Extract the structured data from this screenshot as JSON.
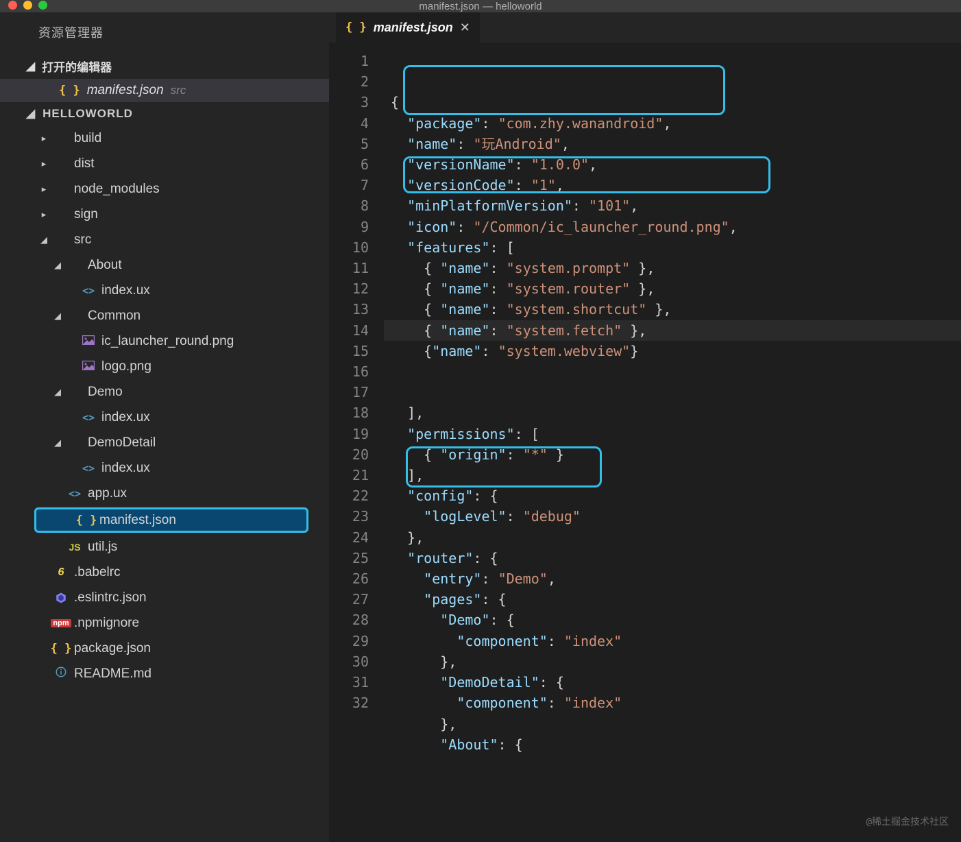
{
  "window": {
    "title": "manifest.json — helloworld"
  },
  "sidebar": {
    "title": "资源管理器",
    "openEditorsLabel": "打开的编辑器",
    "openEditor": {
      "filename": "manifest.json",
      "path": "src"
    },
    "projectName": "HELLOWORLD",
    "tree": [
      {
        "depth": 0,
        "kind": "folder",
        "expanded": false,
        "label": "build"
      },
      {
        "depth": 0,
        "kind": "folder",
        "expanded": false,
        "label": "dist"
      },
      {
        "depth": 0,
        "kind": "folder",
        "expanded": false,
        "label": "node_modules"
      },
      {
        "depth": 0,
        "kind": "folder",
        "expanded": false,
        "label": "sign"
      },
      {
        "depth": 0,
        "kind": "folder",
        "expanded": true,
        "label": "src"
      },
      {
        "depth": 1,
        "kind": "folder",
        "expanded": true,
        "label": "About"
      },
      {
        "depth": 2,
        "kind": "file",
        "icon": "code",
        "label": "index.ux"
      },
      {
        "depth": 1,
        "kind": "folder",
        "expanded": true,
        "label": "Common"
      },
      {
        "depth": 2,
        "kind": "file",
        "icon": "image",
        "label": "ic_launcher_round.png"
      },
      {
        "depth": 2,
        "kind": "file",
        "icon": "image",
        "label": "logo.png"
      },
      {
        "depth": 1,
        "kind": "folder",
        "expanded": true,
        "label": "Demo"
      },
      {
        "depth": 2,
        "kind": "file",
        "icon": "code",
        "label": "index.ux"
      },
      {
        "depth": 1,
        "kind": "folder",
        "expanded": true,
        "label": "DemoDetail"
      },
      {
        "depth": 2,
        "kind": "file",
        "icon": "code",
        "label": "index.ux"
      },
      {
        "depth": 1,
        "kind": "file",
        "icon": "code",
        "label": "app.ux"
      },
      {
        "depth": 1,
        "kind": "file",
        "icon": "braces",
        "label": "manifest.json",
        "selected": true
      },
      {
        "depth": 1,
        "kind": "file",
        "icon": "js",
        "label": "util.js"
      },
      {
        "depth": 0,
        "kind": "file",
        "icon": "babel",
        "label": ".babelrc"
      },
      {
        "depth": 0,
        "kind": "file",
        "icon": "eslint",
        "label": ".eslintrc.json"
      },
      {
        "depth": 0,
        "kind": "file",
        "icon": "npm",
        "label": ".npmignore"
      },
      {
        "depth": 0,
        "kind": "file",
        "icon": "braces",
        "label": "package.json"
      },
      {
        "depth": 0,
        "kind": "file",
        "icon": "info",
        "label": "README.md"
      }
    ]
  },
  "tab": {
    "label": "manifest.json"
  },
  "code": {
    "lines": [
      [
        {
          "t": "brace",
          "v": "{"
        }
      ],
      [
        {
          "t": "sp",
          "v": "  "
        },
        {
          "t": "key",
          "v": "\"package\""
        },
        {
          "t": "punct",
          "v": ": "
        },
        {
          "t": "str",
          "v": "\"com.zhy.wanandroid\""
        },
        {
          "t": "punct",
          "v": ","
        }
      ],
      [
        {
          "t": "sp",
          "v": "  "
        },
        {
          "t": "key",
          "v": "\"name\""
        },
        {
          "t": "punct",
          "v": ": "
        },
        {
          "t": "str",
          "v": "\"玩Android\""
        },
        {
          "t": "punct",
          "v": ","
        }
      ],
      [
        {
          "t": "sp",
          "v": "  "
        },
        {
          "t": "key",
          "v": "\"versionName\""
        },
        {
          "t": "punct",
          "v": ": "
        },
        {
          "t": "str",
          "v": "\"1.0.0\""
        },
        {
          "t": "punct",
          "v": ","
        }
      ],
      [
        {
          "t": "sp",
          "v": "  "
        },
        {
          "t": "key",
          "v": "\"versionCode\""
        },
        {
          "t": "punct",
          "v": ": "
        },
        {
          "t": "str",
          "v": "\"1\""
        },
        {
          "t": "punct",
          "v": ","
        }
      ],
      [
        {
          "t": "sp",
          "v": "  "
        },
        {
          "t": "key",
          "v": "\"minPlatformVersion\""
        },
        {
          "t": "punct",
          "v": ": "
        },
        {
          "t": "str",
          "v": "\"101\""
        },
        {
          "t": "punct",
          "v": ","
        }
      ],
      [
        {
          "t": "sp",
          "v": "  "
        },
        {
          "t": "key",
          "v": "\"icon\""
        },
        {
          "t": "punct",
          "v": ": "
        },
        {
          "t": "str",
          "v": "\"/Common/ic_launcher_round.png\""
        },
        {
          "t": "punct",
          "v": ","
        }
      ],
      [
        {
          "t": "sp",
          "v": "  "
        },
        {
          "t": "key",
          "v": "\"features\""
        },
        {
          "t": "punct",
          "v": ": ["
        }
      ],
      [
        {
          "t": "sp",
          "v": "    "
        },
        {
          "t": "punct",
          "v": "{ "
        },
        {
          "t": "key",
          "v": "\"name\""
        },
        {
          "t": "punct",
          "v": ": "
        },
        {
          "t": "str",
          "v": "\"system.prompt\""
        },
        {
          "t": "punct",
          "v": " },"
        }
      ],
      [
        {
          "t": "sp",
          "v": "    "
        },
        {
          "t": "punct",
          "v": "{ "
        },
        {
          "t": "key",
          "v": "\"name\""
        },
        {
          "t": "punct",
          "v": ": "
        },
        {
          "t": "str",
          "v": "\"system.router\""
        },
        {
          "t": "punct",
          "v": " },"
        }
      ],
      [
        {
          "t": "sp",
          "v": "    "
        },
        {
          "t": "punct",
          "v": "{ "
        },
        {
          "t": "key",
          "v": "\"name\""
        },
        {
          "t": "punct",
          "v": ": "
        },
        {
          "t": "str",
          "v": "\"system.shortcut\""
        },
        {
          "t": "punct",
          "v": " },"
        }
      ],
      [
        {
          "t": "sp",
          "v": "    "
        },
        {
          "t": "punct",
          "v": "{ "
        },
        {
          "t": "key",
          "v": "\"name\""
        },
        {
          "t": "punct",
          "v": ": "
        },
        {
          "t": "str",
          "v": "\"system.fetch\""
        },
        {
          "t": "punct",
          "v": " },"
        }
      ],
      [
        {
          "t": "sp",
          "v": "    "
        },
        {
          "t": "punct",
          "v": "{"
        },
        {
          "t": "key",
          "v": "\"name\""
        },
        {
          "t": "punct",
          "v": ": "
        },
        {
          "t": "str",
          "v": "\"system.webview\""
        },
        {
          "t": "punct",
          "v": "}"
        }
      ],
      [],
      [],
      [
        {
          "t": "sp",
          "v": "  "
        },
        {
          "t": "punct",
          "v": "],"
        }
      ],
      [
        {
          "t": "sp",
          "v": "  "
        },
        {
          "t": "key",
          "v": "\"permissions\""
        },
        {
          "t": "punct",
          "v": ": ["
        }
      ],
      [
        {
          "t": "sp",
          "v": "    "
        },
        {
          "t": "punct",
          "v": "{ "
        },
        {
          "t": "key",
          "v": "\"origin\""
        },
        {
          "t": "punct",
          "v": ": "
        },
        {
          "t": "str",
          "v": "\"*\""
        },
        {
          "t": "punct",
          "v": " }"
        }
      ],
      [
        {
          "t": "sp",
          "v": "  "
        },
        {
          "t": "punct",
          "v": "],"
        }
      ],
      [
        {
          "t": "sp",
          "v": "  "
        },
        {
          "t": "key",
          "v": "\"config\""
        },
        {
          "t": "punct",
          "v": ": {"
        }
      ],
      [
        {
          "t": "sp",
          "v": "    "
        },
        {
          "t": "key",
          "v": "\"logLevel\""
        },
        {
          "t": "punct",
          "v": ": "
        },
        {
          "t": "str",
          "v": "\"debug\""
        }
      ],
      [
        {
          "t": "sp",
          "v": "  "
        },
        {
          "t": "punct",
          "v": "},"
        }
      ],
      [
        {
          "t": "sp",
          "v": "  "
        },
        {
          "t": "key",
          "v": "\"router\""
        },
        {
          "t": "punct",
          "v": ": {"
        }
      ],
      [
        {
          "t": "sp",
          "v": "    "
        },
        {
          "t": "key",
          "v": "\"entry\""
        },
        {
          "t": "punct",
          "v": ": "
        },
        {
          "t": "str",
          "v": "\"Demo\""
        },
        {
          "t": "punct",
          "v": ","
        }
      ],
      [
        {
          "t": "sp",
          "v": "    "
        },
        {
          "t": "key",
          "v": "\"pages\""
        },
        {
          "t": "punct",
          "v": ": {"
        }
      ],
      [
        {
          "t": "sp",
          "v": "      "
        },
        {
          "t": "key",
          "v": "\"Demo\""
        },
        {
          "t": "punct",
          "v": ": {"
        }
      ],
      [
        {
          "t": "sp",
          "v": "        "
        },
        {
          "t": "key",
          "v": "\"component\""
        },
        {
          "t": "punct",
          "v": ": "
        },
        {
          "t": "str",
          "v": "\"index\""
        }
      ],
      [
        {
          "t": "sp",
          "v": "      "
        },
        {
          "t": "punct",
          "v": "},"
        }
      ],
      [
        {
          "t": "sp",
          "v": "      "
        },
        {
          "t": "key",
          "v": "\"DemoDetail\""
        },
        {
          "t": "punct",
          "v": ": {"
        }
      ],
      [
        {
          "t": "sp",
          "v": "        "
        },
        {
          "t": "key",
          "v": "\"component\""
        },
        {
          "t": "punct",
          "v": ": "
        },
        {
          "t": "str",
          "v": "\"index\""
        }
      ],
      [
        {
          "t": "sp",
          "v": "      "
        },
        {
          "t": "punct",
          "v": "},"
        }
      ],
      [
        {
          "t": "sp",
          "v": "      "
        },
        {
          "t": "key",
          "v": "\"About\""
        },
        {
          "t": "punct",
          "v": ": {"
        }
      ]
    ],
    "currentLine": 14
  },
  "watermark": "@稀土掘金技术社区"
}
